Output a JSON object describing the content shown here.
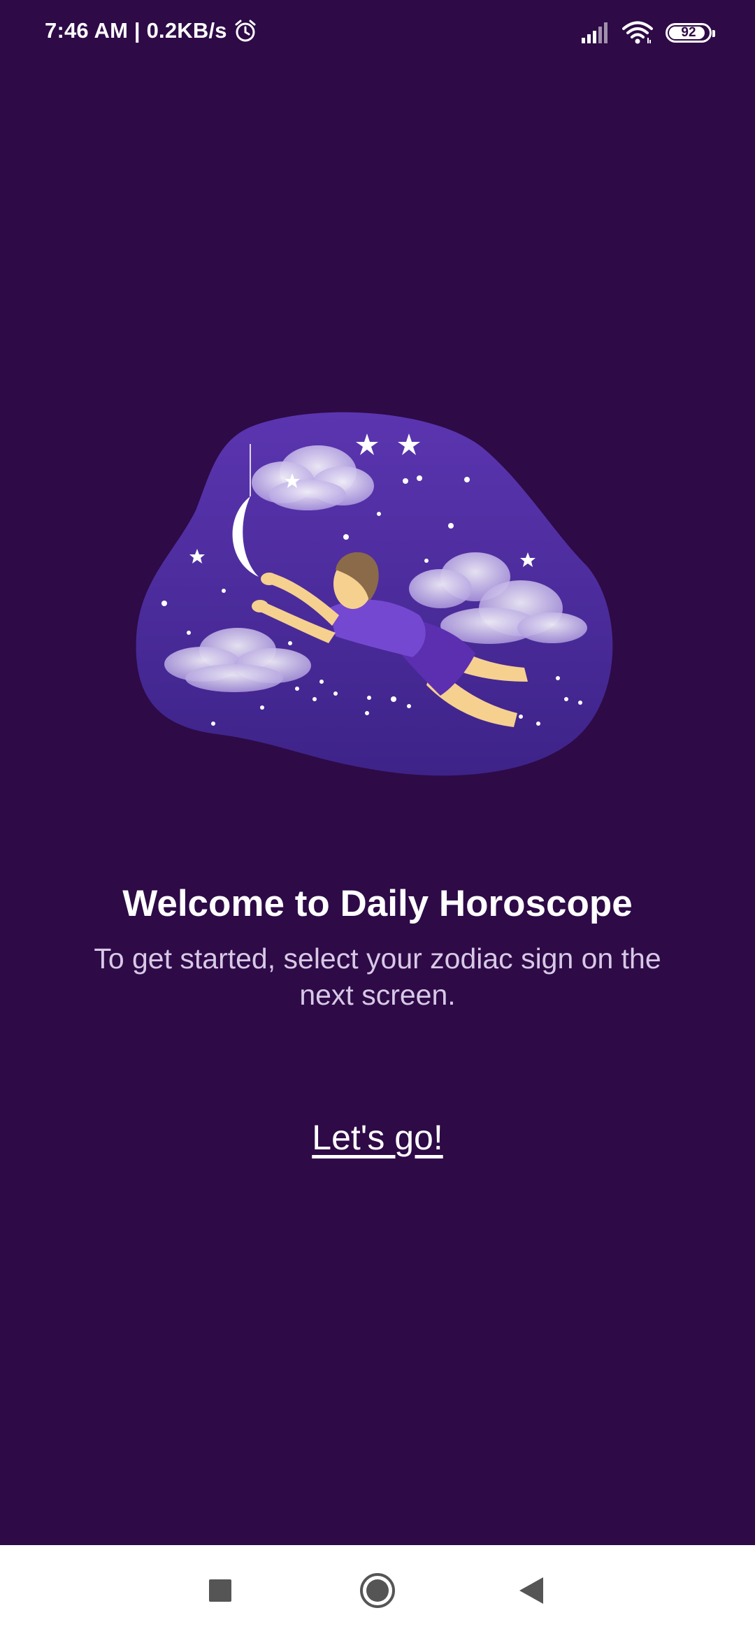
{
  "status_bar": {
    "time_speed": "7:46 AM | 0.2KB/s",
    "alarm_icon": "alarm-icon",
    "signal_icon": "signal-icon",
    "wifi_icon": "wifi-icon",
    "battery_level": "92",
    "battery_fraction": 0.92
  },
  "illustration": {
    "icon": "dreaming-person-moon-illustration"
  },
  "welcome": {
    "title": "Welcome to Daily Horoscope",
    "subtitle": "To get started, select your zodiac sign on the next screen.",
    "cta_label": "Let's go!"
  },
  "nav_bar": {
    "recents_icon": "square-icon",
    "home_icon": "circle-icon",
    "back_icon": "triangle-back-icon"
  },
  "colors": {
    "background": "#2e0a47",
    "illustration_blob": "#5b35b0",
    "text_primary": "#ffffff",
    "text_secondary": "#d7c9e6"
  }
}
